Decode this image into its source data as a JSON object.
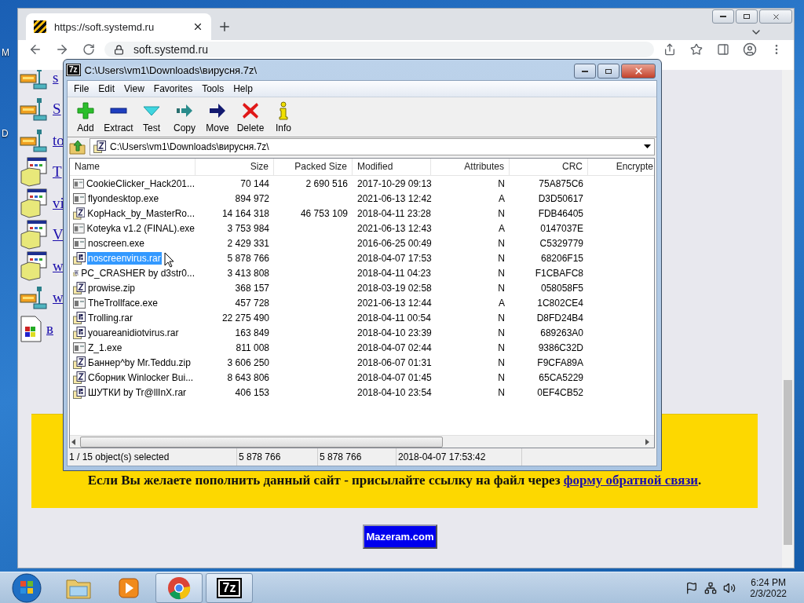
{
  "desktop": {
    "labels": [
      "M",
      "D"
    ]
  },
  "browser": {
    "tab": {
      "title": "https://soft.systemd.ru",
      "selected": true
    },
    "address": "soft.systemd.ru"
  },
  "page": {
    "links": [
      {
        "text": "s",
        "kind": "tool"
      },
      {
        "text": "S",
        "kind": "tool"
      },
      {
        "text": "to",
        "kind": "tool"
      },
      {
        "text": "T",
        "kind": "window"
      },
      {
        "text": "vi",
        "kind": "window"
      },
      {
        "text": "V",
        "kind": "window"
      },
      {
        "text": "w",
        "kind": "window"
      },
      {
        "text": "w",
        "kind": "tool"
      },
      {
        "text": "в",
        "kind": "doc"
      }
    ],
    "banner": {
      "text": "Если Вы желаете пополнить данный сайт - присылайте ссылку на файл через ",
      "link": "форму обратной связи",
      "end": "."
    },
    "badge": "Mazeram.com"
  },
  "archiver": {
    "logo": "7z",
    "title": "C:\\Users\\vm1\\Downloads\\вирусня.7z\\",
    "menu": [
      "File",
      "Edit",
      "View",
      "Favorites",
      "Tools",
      "Help"
    ],
    "toolbar": [
      {
        "label": "Add",
        "kind": "add"
      },
      {
        "label": "Extract",
        "kind": "extract"
      },
      {
        "label": "Test",
        "kind": "test"
      },
      {
        "label": "Copy",
        "kind": "copy"
      },
      {
        "label": "Move",
        "kind": "move"
      },
      {
        "label": "Delete",
        "kind": "delete"
      },
      {
        "label": "Info",
        "kind": "info"
      }
    ],
    "path": "C:\\Users\\vm1\\Downloads\\вирусня.7z\\",
    "columns": [
      "Name",
      "Size",
      "Packed Size",
      "Modified",
      "Attributes",
      "CRC",
      "Encrypte"
    ],
    "rows": [
      {
        "name": "CookieClicker_Hack201...",
        "size": "70 144",
        "packed": "2 690 516",
        "modified": "2017-10-29 09:13",
        "attributes": "N",
        "crc": "75A875C6",
        "kind": "exe",
        "selected": false
      },
      {
        "name": "flyondesktop.exe",
        "size": "894 972",
        "modified": "2021-06-13 12:42",
        "attributes": "A",
        "crc": "D3D50617",
        "kind": "exe",
        "selected": false
      },
      {
        "name": "KopHack_by_MasterRo...",
        "size": "14 164 318",
        "packed": "46 753 109",
        "modified": "2018-04-11 23:28",
        "attributes": "N",
        "crc": "FDB46405",
        "kind": "zip",
        "selected": false
      },
      {
        "name": "Koteyka v1.2 (FINAL).exe",
        "size": "3 753 984",
        "modified": "2021-06-13 12:43",
        "attributes": "A",
        "crc": "0147037E",
        "kind": "exe",
        "selected": false
      },
      {
        "name": "noscreen.exe",
        "size": "2 429 331",
        "modified": "2016-06-25 00:49",
        "attributes": "N",
        "crc": "C5329779",
        "kind": "exe",
        "selected": false
      },
      {
        "name": "noscreenvirus.rar",
        "size": "5 878 766",
        "modified": "2018-04-07 17:53",
        "attributes": "N",
        "crc": "68206F15",
        "kind": "rar",
        "selected": true
      },
      {
        "name": "PC_CRASHER by d3str0...",
        "size": "3 413 808",
        "modified": "2018-04-11 04:23",
        "attributes": "N",
        "crc": "F1CBAFC8",
        "kind": "rar",
        "selected": false
      },
      {
        "name": "prowise.zip",
        "size": "368 157",
        "modified": "2018-03-19 02:58",
        "attributes": "N",
        "crc": "058058F5",
        "kind": "zip",
        "selected": false
      },
      {
        "name": "TheTrollface.exe",
        "size": "457 728",
        "modified": "2021-06-13 12:44",
        "attributes": "A",
        "crc": "1C802CE4",
        "kind": "exe",
        "selected": false
      },
      {
        "name": "Trolling.rar",
        "size": "22 275 490",
        "modified": "2018-04-11 00:54",
        "attributes": "N",
        "crc": "D8FD24B4",
        "kind": "rar",
        "selected": false
      },
      {
        "name": "youareanidiotvirus.rar",
        "size": "163 849",
        "modified": "2018-04-10 23:39",
        "attributes": "N",
        "crc": "689263A0",
        "kind": "rar",
        "selected": false
      },
      {
        "name": "Z_1.exe",
        "size": "811 008",
        "modified": "2018-04-07 02:44",
        "attributes": "N",
        "crc": "9386C32D",
        "kind": "exe",
        "selected": false
      },
      {
        "name": "Баннер^by Mr.Teddu.zip",
        "size": "3 606 250",
        "modified": "2018-06-07 01:31",
        "attributes": "N",
        "crc": "F9CFA89A",
        "kind": "zip",
        "selected": false
      },
      {
        "name": "Сборник Winlocker Bui...",
        "size": "8 643 806",
        "modified": "2018-04-07 01:45",
        "attributes": "N",
        "crc": "65CA5229",
        "kind": "zip",
        "selected": false
      },
      {
        "name": "ШУТКИ by Tr@llInX.rar",
        "size": "406 153",
        "modified": "2018-04-10 23:54",
        "attributes": "N",
        "crc": "0EF4CB52",
        "kind": "rar",
        "selected": false
      }
    ],
    "status": [
      "1 / 15 object(s) selected",
      "5 878 766",
      "5 878 766",
      "2018-04-07 17:53:42"
    ]
  },
  "taskbar": {
    "apps": [
      {
        "kind": "explorer",
        "running": false
      },
      {
        "kind": "media",
        "running": false
      },
      {
        "kind": "browser",
        "running": true
      },
      {
        "kind": "archiver",
        "label": "7z",
        "running": true
      }
    ],
    "clock": {
      "time": "6:24 PM",
      "date": "2/3/2022"
    }
  }
}
